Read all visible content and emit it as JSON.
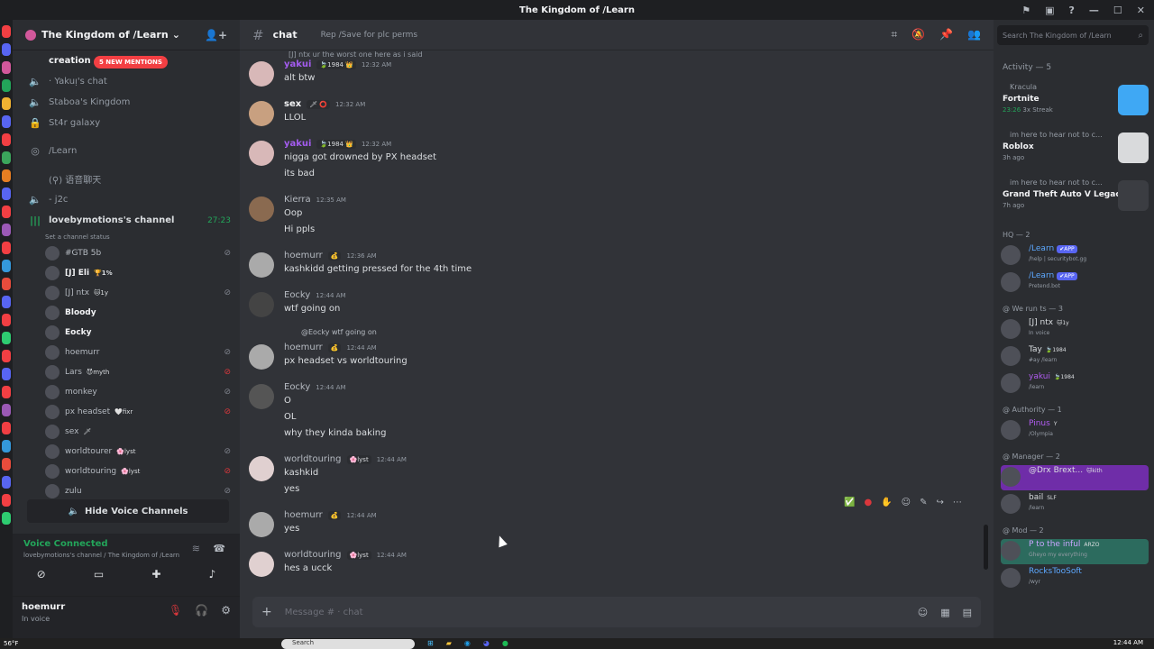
{
  "window": {
    "title": "The Kingdom of /Learn"
  },
  "guild": {
    "name": "The Kingdom of /Learn"
  },
  "sidebar": {
    "new_mentions": "5 NEW MENTIONS",
    "channels": [
      {
        "icon": "speaker",
        "label": "· Yakuᴉ's chat"
      },
      {
        "icon": "speaker",
        "label": "Staboa's Kingdom"
      },
      {
        "icon": "lock",
        "label": "St4r galaxy"
      },
      {
        "icon": "stage",
        "label": "/Learn"
      },
      {
        "icon": "category",
        "label": "(⚲) 语音聊天"
      },
      {
        "icon": "speaker",
        "label": "- j2c"
      }
    ],
    "voice_channel": {
      "name": "lovebymotions's channel",
      "timer": "27:23",
      "status": "Set a channel status"
    },
    "voice_users": [
      {
        "name": "#GTB 5b",
        "badge": "",
        "bold": false,
        "muted": "muted"
      },
      {
        "name": "[J] Eli",
        "badge": "🏆1%",
        "bold": true,
        "muted": ""
      },
      {
        "name": "[J] ntx",
        "badge": "🐱1y",
        "bold": false,
        "muted": "muted"
      },
      {
        "name": "Bloody",
        "badge": "",
        "bold": true,
        "muted": ""
      },
      {
        "name": "Eocky",
        "badge": "",
        "bold": true,
        "muted": ""
      },
      {
        "name": "hoemurr",
        "badge": "",
        "bold": false,
        "muted": "muted"
      },
      {
        "name": "Lars",
        "badge": "😈myth",
        "bold": false,
        "muted": "red"
      },
      {
        "name": "monkey",
        "badge": "",
        "bold": false,
        "muted": "muted"
      },
      {
        "name": "px headset",
        "badge": "🤍fixr",
        "bold": false,
        "muted": "red"
      },
      {
        "name": "sex",
        "badge": "🗡",
        "bold": false,
        "muted": ""
      },
      {
        "name": "worldtourer",
        "badge": "🌸lyst",
        "bold": false,
        "muted": "muted"
      },
      {
        "name": "worldtouring",
        "badge": "🌸lyst",
        "bold": false,
        "muted": "red"
      },
      {
        "name": "zulu",
        "badge": "",
        "bold": false,
        "muted": "muted"
      }
    ],
    "hide_voice_label": "Hide Voice Channels"
  },
  "voice_panel": {
    "status": "Voice Connected",
    "sub": "lovebymotions's channel / The Kingdom of /Learn"
  },
  "user_panel": {
    "name": "hoemurr",
    "status": "In voice"
  },
  "chat": {
    "channel": "chat",
    "topic": "Rep /Save for plc perms",
    "input_placeholder": "Message # · chat",
    "messages": [
      {
        "user": "yakui",
        "style": "purple",
        "tag": "🍃1984 👑",
        "time": "12:32 AM",
        "lines": [
          "alt btw"
        ]
      },
      {
        "user": "sex",
        "style": "",
        "tag": "🗡 ⭕",
        "time": "12:32 AM",
        "lines": [
          "LLOL"
        ]
      },
      {
        "user": "yakui",
        "style": "purple",
        "tag": "🍃1984 👑",
        "time": "12:32 AM",
        "lines": [
          "nigga got drowned by PX headset",
          "its bad"
        ]
      },
      {
        "user": "Kierra",
        "style": "grey",
        "tag": "",
        "time": "12:35 AM",
        "lines": [
          "Oop",
          "Hi ppls"
        ]
      },
      {
        "user": "hoemurr",
        "style": "grey",
        "tag": "💰",
        "time": "12:36 AM",
        "lines": [
          "kashkidd getting pressed for the 4th time"
        ]
      },
      {
        "user": "Eocky",
        "style": "grey",
        "tag": "",
        "time": "12:44 AM",
        "lines": [
          "wtf going on"
        ]
      },
      {
        "user": "hoemurr",
        "style": "grey",
        "tag": "💰",
        "time": "12:44 AM",
        "lines": [
          "px headset vs worldtouring"
        ],
        "reply": "@Eocky wtf going on"
      },
      {
        "user": "Eocky",
        "style": "grey",
        "tag": "",
        "time": "12:44 AM",
        "lines": [
          "O",
          "OL",
          "why they kinda baking"
        ]
      },
      {
        "user": "worldtouring",
        "style": "grey",
        "tag": "🌸lyst",
        "time": "12:44 AM",
        "lines": [
          "kashkid",
          "yes"
        ]
      },
      {
        "user": "hoemurr",
        "style": "grey",
        "tag": "💰",
        "time": "12:44 AM",
        "lines": [
          "yes"
        ]
      },
      {
        "user": "worldtouring",
        "style": "grey",
        "tag": "🌸lyst",
        "time": "12:44 AM",
        "lines": [
          "hes a ucck"
        ]
      }
    ],
    "top_partial": "[J] ntx ur the worst one here as i said"
  },
  "activity": {
    "search_placeholder": "Search The Kingdom of /Learn",
    "header": "Activity — 5",
    "items": [
      {
        "who": "Kracula",
        "game": "Fortnite",
        "meta_time": "23:26",
        "meta": "3x Streak",
        "thumb_color": "#3fa8f4"
      },
      {
        "who": "im here to hear not to c...",
        "game": "Roblox",
        "meta_time": "",
        "meta": "3h ago",
        "thumb_color": "#d9dadc"
      },
      {
        "who": "im here to hear not to c...",
        "game": "Grand Theft Auto V Legacy",
        "meta_time": "",
        "meta": "7h ago",
        "thumb_color": "#3b3d42"
      }
    ],
    "sections": [
      {
        "title": "HQ — 2",
        "members": [
          {
            "name": "/Learn",
            "style": "blue",
            "badge": "✔APP",
            "tag": "",
            "status": "/help | securitybot.gg"
          },
          {
            "name": "/Learn",
            "style": "blue",
            "badge": "✔APP",
            "tag": "",
            "status": "Pretend.bot"
          }
        ]
      },
      {
        "title": "@ We run ts — 3",
        "members": [
          {
            "name": "[J] ntx",
            "style": "",
            "badge": "",
            "tag": "🐱1y",
            "status": "In voice"
          },
          {
            "name": "Tay",
            "style": "",
            "badge": "",
            "tag": "🍃1984",
            "status": "#ay /learn"
          },
          {
            "name": "yakui",
            "style": "purple",
            "badge": "",
            "tag": "🍃1984",
            "status": "/learn"
          }
        ]
      },
      {
        "title": "@ Authority — 1",
        "members": [
          {
            "name": "Pinus",
            "style": "purple",
            "badge": "",
            "tag": "Y",
            "status": "/Olympia"
          }
        ]
      },
      {
        "title": "@ Manager — 2",
        "members": [
          {
            "name": "@Drx Brext...",
            "style": "",
            "badge": "",
            "tag": "🐱kith",
            "status": "",
            "hl": "hl"
          },
          {
            "name": "bail",
            "style": "",
            "badge": "",
            "tag": "SLF",
            "status": "/learn"
          }
        ]
      },
      {
        "title": "@ Mod — 2",
        "members": [
          {
            "name": "P to the inful",
            "style": "pink",
            "badge": "",
            "tag": "ARZO",
            "status": "Gheyo my everything",
            "hl": "hl2"
          },
          {
            "name": "RocksTooSoft",
            "style": "blue",
            "badge": "",
            "tag": "",
            "status": "/wyr"
          }
        ]
      }
    ]
  },
  "taskbar": {
    "weather": "56°F",
    "search": "Search",
    "time": "12:44 AM"
  },
  "colors": {
    "accent": "#5865f2",
    "online": "#23a55a",
    "danger": "#da373c",
    "mention": "#f23f43"
  }
}
